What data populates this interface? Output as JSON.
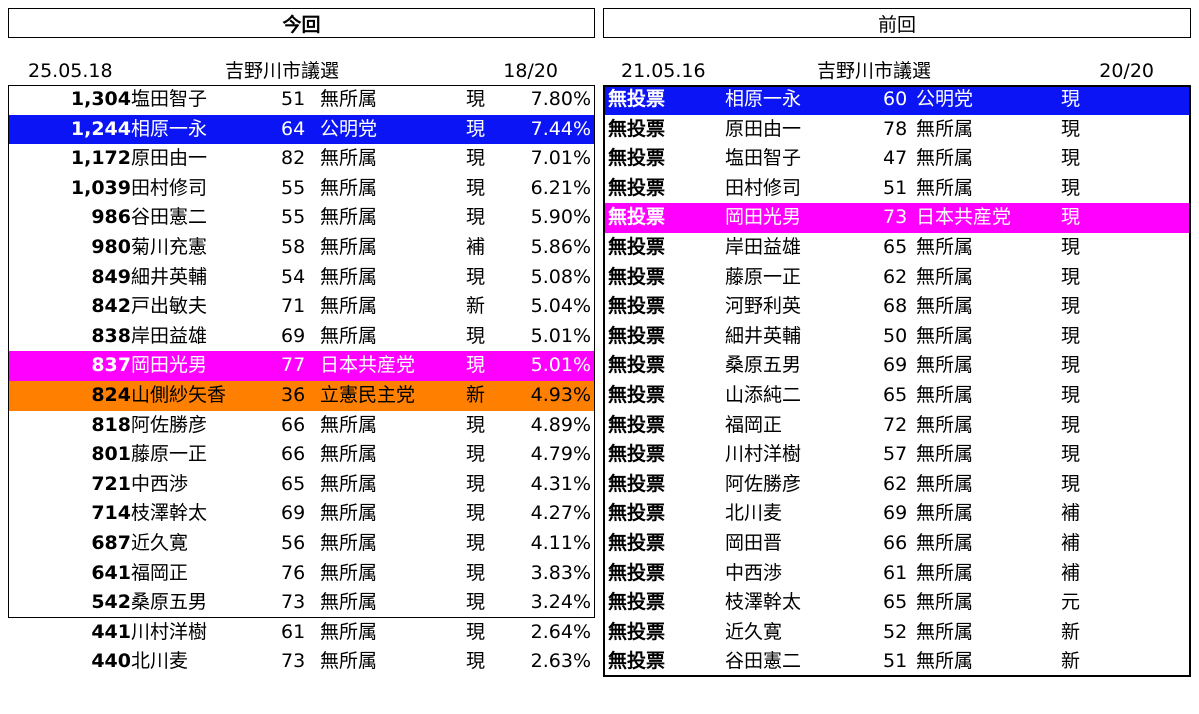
{
  "current": {
    "header": "今回",
    "date": "25.05.18",
    "title": "吉野川市議選",
    "seats": "18/20",
    "rows": [
      {
        "votes": "1,304",
        "name": "塩田智子",
        "age": "51",
        "party": "無所属",
        "status": "現",
        "pct": "7.80%",
        "bg": ""
      },
      {
        "votes": "1,244",
        "name": "相原一永",
        "age": "64",
        "party": "公明党",
        "status": "現",
        "pct": "7.44%",
        "bg": "#0a14f5"
      },
      {
        "votes": "1,172",
        "name": "原田由一",
        "age": "82",
        "party": "無所属",
        "status": "現",
        "pct": "7.01%",
        "bg": ""
      },
      {
        "votes": "1,039",
        "name": "田村修司",
        "age": "55",
        "party": "無所属",
        "status": "現",
        "pct": "6.21%",
        "bg": ""
      },
      {
        "votes": "986",
        "name": "谷田憲二",
        "age": "55",
        "party": "無所属",
        "status": "現",
        "pct": "5.90%",
        "bg": ""
      },
      {
        "votes": "980",
        "name": "菊川充憲",
        "age": "58",
        "party": "無所属",
        "status": "補",
        "pct": "5.86%",
        "bg": ""
      },
      {
        "votes": "849",
        "name": "細井英輔",
        "age": "54",
        "party": "無所属",
        "status": "現",
        "pct": "5.08%",
        "bg": ""
      },
      {
        "votes": "842",
        "name": "戸出敏夫",
        "age": "71",
        "party": "無所属",
        "status": "新",
        "pct": "5.04%",
        "bg": ""
      },
      {
        "votes": "838",
        "name": "岸田益雄",
        "age": "69",
        "party": "無所属",
        "status": "現",
        "pct": "5.01%",
        "bg": ""
      },
      {
        "votes": "837",
        "name": "岡田光男",
        "age": "77",
        "party": "日本共産党",
        "status": "現",
        "pct": "5.01%",
        "bg": "#ff00ff"
      },
      {
        "votes": "824",
        "name": "山側紗矢香",
        "age": "36",
        "party": "立憲民主党",
        "status": "新",
        "pct": "4.93%",
        "bg": "#ff7f00"
      },
      {
        "votes": "818",
        "name": "阿佐勝彦",
        "age": "66",
        "party": "無所属",
        "status": "現",
        "pct": "4.89%",
        "bg": ""
      },
      {
        "votes": "801",
        "name": "藤原一正",
        "age": "66",
        "party": "無所属",
        "status": "現",
        "pct": "4.79%",
        "bg": ""
      },
      {
        "votes": "721",
        "name": "中西渉",
        "age": "65",
        "party": "無所属",
        "status": "現",
        "pct": "4.31%",
        "bg": ""
      },
      {
        "votes": "714",
        "name": "枝澤幹太",
        "age": "69",
        "party": "無所属",
        "status": "現",
        "pct": "4.27%",
        "bg": ""
      },
      {
        "votes": "687",
        "name": "近久寛",
        "age": "56",
        "party": "無所属",
        "status": "現",
        "pct": "4.11%",
        "bg": ""
      },
      {
        "votes": "641",
        "name": "福岡正",
        "age": "76",
        "party": "無所属",
        "status": "現",
        "pct": "3.83%",
        "bg": ""
      },
      {
        "votes": "542",
        "name": "桑原五男",
        "age": "73",
        "party": "無所属",
        "status": "現",
        "pct": "3.24%",
        "bg": ""
      },
      {
        "votes": "441",
        "name": "川村洋樹",
        "age": "61",
        "party": "無所属",
        "status": "現",
        "pct": "2.64%",
        "bg": ""
      },
      {
        "votes": "440",
        "name": "北川麦",
        "age": "73",
        "party": "無所属",
        "status": "現",
        "pct": "2.63%",
        "bg": ""
      }
    ]
  },
  "previous": {
    "header": "前回",
    "date": "21.05.16",
    "title": "吉野川市議選",
    "seats": "20/20",
    "rows": [
      {
        "result": "無投票",
        "name": "相原一永",
        "age": "60",
        "party": "公明党",
        "status": "現",
        "bg": "#0a14f5"
      },
      {
        "result": "無投票",
        "name": "原田由一",
        "age": "78",
        "party": "無所属",
        "status": "現",
        "bg": ""
      },
      {
        "result": "無投票",
        "name": "塩田智子",
        "age": "47",
        "party": "無所属",
        "status": "現",
        "bg": ""
      },
      {
        "result": "無投票",
        "name": "田村修司",
        "age": "51",
        "party": "無所属",
        "status": "現",
        "bg": ""
      },
      {
        "result": "無投票",
        "name": "岡田光男",
        "age": "73",
        "party": "日本共産党",
        "status": "現",
        "bg": "#ff00ff"
      },
      {
        "result": "無投票",
        "name": "岸田益雄",
        "age": "65",
        "party": "無所属",
        "status": "現",
        "bg": ""
      },
      {
        "result": "無投票",
        "name": "藤原一正",
        "age": "62",
        "party": "無所属",
        "status": "現",
        "bg": ""
      },
      {
        "result": "無投票",
        "name": "河野利英",
        "age": "68",
        "party": "無所属",
        "status": "現",
        "bg": ""
      },
      {
        "result": "無投票",
        "name": "細井英輔",
        "age": "50",
        "party": "無所属",
        "status": "現",
        "bg": ""
      },
      {
        "result": "無投票",
        "name": "桑原五男",
        "age": "69",
        "party": "無所属",
        "status": "現",
        "bg": ""
      },
      {
        "result": "無投票",
        "name": "山添純二",
        "age": "65",
        "party": "無所属",
        "status": "現",
        "bg": ""
      },
      {
        "result": "無投票",
        "name": "福岡正",
        "age": "72",
        "party": "無所属",
        "status": "現",
        "bg": ""
      },
      {
        "result": "無投票",
        "name": "川村洋樹",
        "age": "57",
        "party": "無所属",
        "status": "現",
        "bg": ""
      },
      {
        "result": "無投票",
        "name": "阿佐勝彦",
        "age": "62",
        "party": "無所属",
        "status": "現",
        "bg": ""
      },
      {
        "result": "無投票",
        "name": "北川麦",
        "age": "69",
        "party": "無所属",
        "status": "補",
        "bg": ""
      },
      {
        "result": "無投票",
        "name": "岡田晋",
        "age": "66",
        "party": "無所属",
        "status": "補",
        "bg": ""
      },
      {
        "result": "無投票",
        "name": "中西渉",
        "age": "61",
        "party": "無所属",
        "status": "補",
        "bg": ""
      },
      {
        "result": "無投票",
        "name": "枝澤幹太",
        "age": "65",
        "party": "無所属",
        "status": "元",
        "bg": ""
      },
      {
        "result": "無投票",
        "name": "近久寛",
        "age": "52",
        "party": "無所属",
        "status": "新",
        "bg": ""
      },
      {
        "result": "無投票",
        "name": "谷田憲二",
        "age": "51",
        "party": "無所属",
        "status": "新",
        "bg": ""
      }
    ]
  }
}
